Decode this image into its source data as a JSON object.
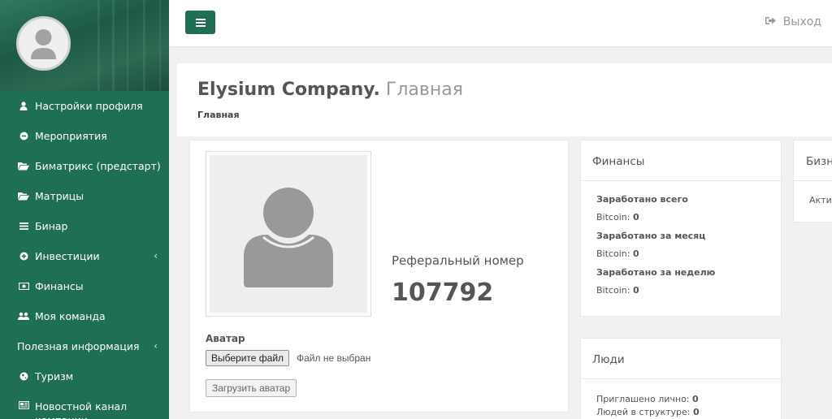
{
  "sidebar": {
    "items": [
      {
        "label": "Настройки профиля",
        "icon": "user-icon"
      },
      {
        "label": "Мероприятия",
        "icon": "circle-icon"
      },
      {
        "label": "Биматрикс (предстарт)",
        "icon": "folder-open-icon"
      },
      {
        "label": "Матрицы",
        "icon": "folder-open-icon"
      },
      {
        "label": "Бинар",
        "icon": "bars-icon"
      },
      {
        "label": "Инвестиции",
        "icon": "circle-plus-icon",
        "chevron": "‹"
      },
      {
        "label": "Финансы",
        "icon": "money-icon"
      },
      {
        "label": "Моя команда",
        "icon": "users-icon"
      },
      {
        "label": "Полезная информация",
        "chevron": "‹"
      },
      {
        "label": "Туризм",
        "icon": "globe-icon"
      },
      {
        "label": "Новостной канал компании",
        "icon": "newspaper-icon"
      }
    ]
  },
  "topbar": {
    "menu_icon": "≡",
    "logout_label": "Выход"
  },
  "page": {
    "company": "Elysium Company.",
    "title": "Главная",
    "breadcrumb": "Главная"
  },
  "profile": {
    "referral_label": "Реферальный номер",
    "referral_number": "107792",
    "avatar_label": "Аватар",
    "choose_file_label": "Выберите файл",
    "file_status": "Файл не выбран",
    "upload_label": "Загрузить аватар"
  },
  "finance": {
    "title": "Финансы",
    "rows": [
      {
        "label": "Заработано всего",
        "currency": "Bitcoin:",
        "value": "0"
      },
      {
        "label": "Заработано за месяц",
        "currency": "Bitcoin:",
        "value": "0"
      },
      {
        "label": "Заработано за неделю",
        "currency": "Bitcoin:",
        "value": "0"
      }
    ]
  },
  "people": {
    "title": "Люди",
    "invited_label": "Приглашено лично:",
    "invited_value": "0",
    "structure_label": "Людей в структуре:",
    "structure_value": "0"
  },
  "business": {
    "title": "Бизн",
    "status": "Акти"
  },
  "colors": {
    "brand": "#1f6f55",
    "sidebar_text": "#ffffff",
    "panel_bg": "#ffffff",
    "page_bg": "#f1f1f1"
  }
}
